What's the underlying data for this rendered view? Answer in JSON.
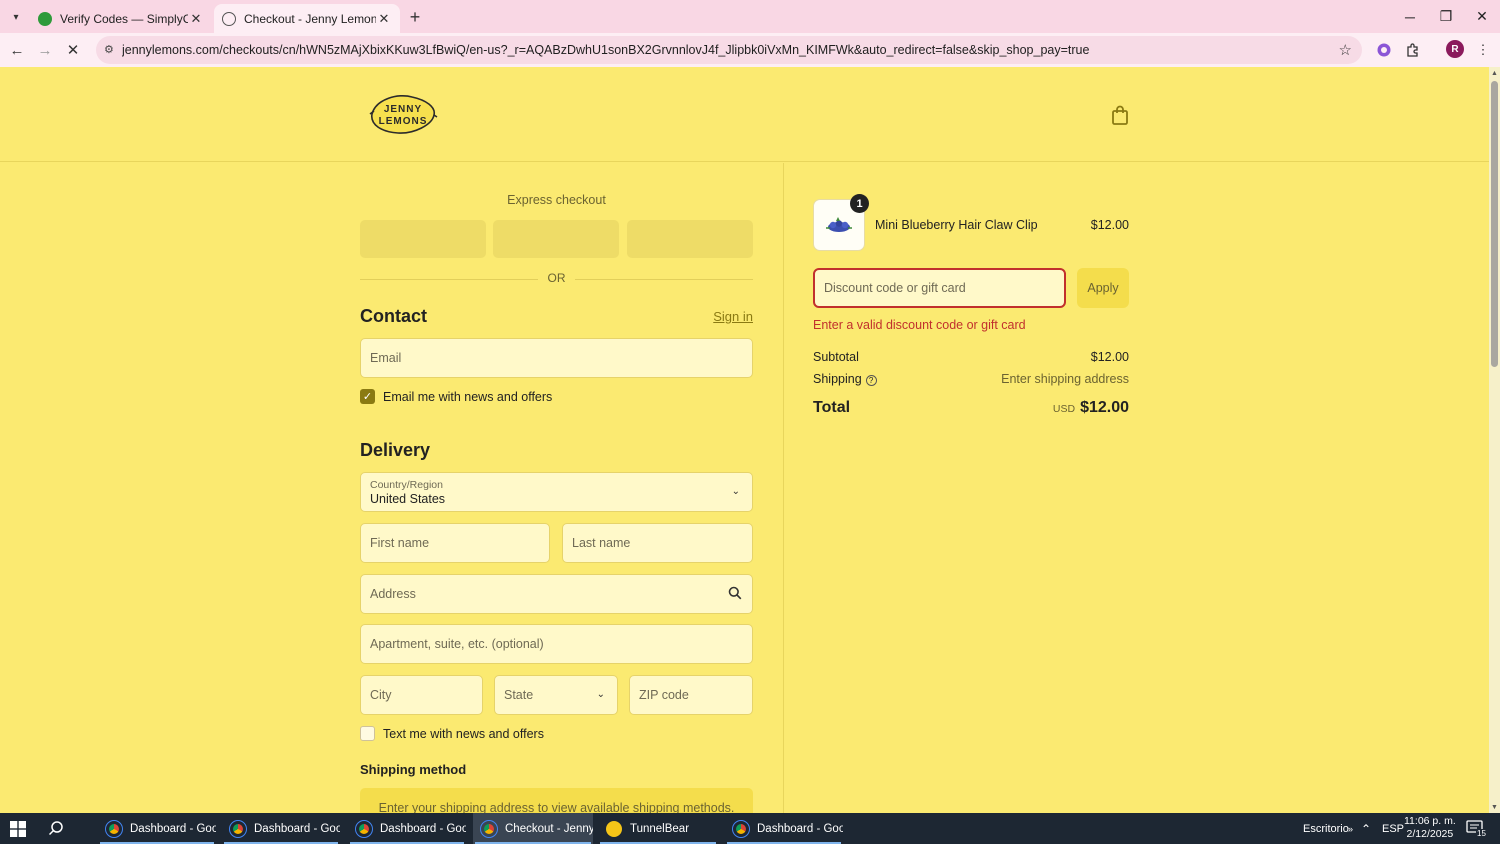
{
  "browser": {
    "tabs": [
      {
        "title": "Verify Codes — SimplyCodes",
        "favicon_color": "#2e9a3a",
        "active": false
      },
      {
        "title": "Checkout - Jenny Lemons",
        "favicon_color": "#555555",
        "active": true
      }
    ],
    "url": "jennylemons.com/checkouts/cn/hWN5zMAjXbixKKuw3LfBwiQ/en-us?_r=AQABzDwhU1sonBX2GrvnnlovJ4f_Jlipbk0iVxMn_KIMFWk&auto_redirect=false&skip_shop_pay=true",
    "profile_initial": "R",
    "accent_color": "#f9d7e4"
  },
  "header": {
    "logo_text_1": "JENNY",
    "logo_text_2": "LEMONS",
    "bag_icon": "shopping-bag-icon"
  },
  "express": {
    "label": "Express checkout",
    "or_text": "OR"
  },
  "contact": {
    "heading": "Contact",
    "sign_in": "Sign in",
    "email_placeholder": "Email",
    "newsletter_label": "Email me with news and offers",
    "newsletter_checked": true
  },
  "delivery": {
    "heading": "Delivery",
    "country_label": "Country/Region",
    "country_value": "United States",
    "first_name_placeholder": "First name",
    "last_name_placeholder": "Last name",
    "address_placeholder": "Address",
    "apartment_placeholder": "Apartment, suite, etc. (optional)",
    "city_placeholder": "City",
    "state_placeholder": "State",
    "zip_placeholder": "ZIP code",
    "sms_label": "Text me with news and offers",
    "sms_checked": false
  },
  "shipping_method": {
    "heading": "Shipping method",
    "notice": "Enter your shipping address to view available shipping methods."
  },
  "summary": {
    "item": {
      "name": "Mini Blueberry Hair Claw Clip",
      "price": "$12.00",
      "quantity": "1"
    },
    "discount_placeholder": "Discount code or gift card",
    "apply_label": "Apply",
    "error": "Enter a valid discount code or gift card",
    "subtotal_label": "Subtotal",
    "subtotal_value": "$12.00",
    "shipping_label": "Shipping",
    "shipping_value": "Enter shipping address",
    "total_label": "Total",
    "currency": "USD",
    "total_value": "$12.00",
    "error_color": "#c1302d"
  },
  "taskbar": {
    "apps": [
      {
        "label": "Dashboard - Googl...",
        "active": false
      },
      {
        "label": "Dashboard - Googl...",
        "active": false
      },
      {
        "label": "Dashboard - Googl...",
        "active": false
      },
      {
        "label": "Checkout - Jenny L...",
        "active": true
      },
      {
        "label": "TunnelBear",
        "active": false
      },
      {
        "label": "Dashboard - Googl...",
        "active": false
      }
    ],
    "desktop_label": "Escritorio",
    "language": "ESP",
    "time": "11:06 p. m.",
    "date": "2/12/2025",
    "notification_count": "15"
  }
}
